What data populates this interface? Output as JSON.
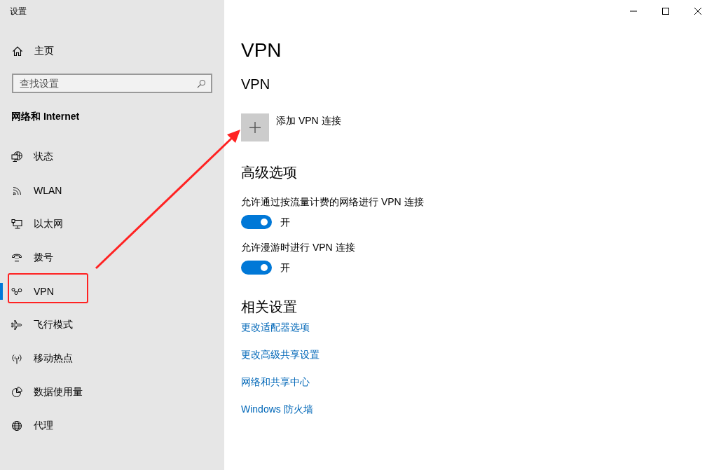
{
  "window": {
    "title": "设置"
  },
  "sidebar": {
    "home": "主页",
    "search": {
      "placeholder": "查找设置"
    },
    "section": "网络和 Internet",
    "items": [
      {
        "label": "状态",
        "selected": false
      },
      {
        "label": "WLAN",
        "selected": false
      },
      {
        "label": "以太网",
        "selected": false
      },
      {
        "label": "拨号",
        "selected": false
      },
      {
        "label": "VPN",
        "selected": true
      },
      {
        "label": "飞行模式",
        "selected": false
      },
      {
        "label": "移动热点",
        "selected": false
      },
      {
        "label": "数据使用量",
        "selected": false
      },
      {
        "label": "代理",
        "selected": false
      }
    ]
  },
  "page": {
    "title": "VPN",
    "vpn_section": {
      "heading": "VPN",
      "add_button": "添加 VPN 连接"
    },
    "advanced": {
      "heading": "高级选项",
      "options": [
        {
          "label": "允许通过按流量计费的网络进行 VPN 连接",
          "on": true,
          "state_text": "开"
        },
        {
          "label": "允许漫游时进行 VPN 连接",
          "on": true,
          "state_text": "开"
        }
      ]
    },
    "related": {
      "heading": "相关设置",
      "links": [
        "更改适配器选项",
        "更改高级共享设置",
        "网络和共享中心",
        "Windows 防火墙"
      ]
    }
  },
  "annotations": {
    "highlight_box": true,
    "arrow": true
  }
}
